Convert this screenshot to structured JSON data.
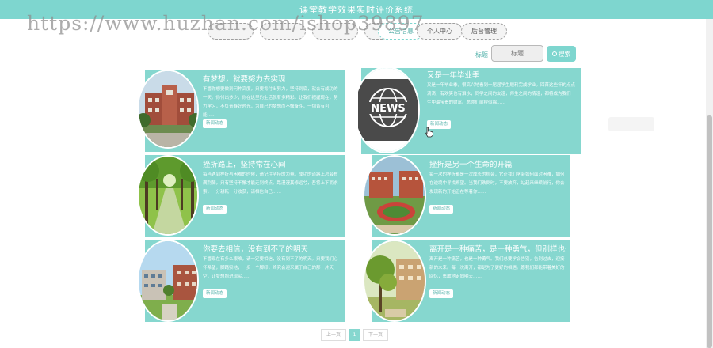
{
  "header": {
    "title": "课堂教学效果实时评价系统"
  },
  "watermark": "https://www.huzhan.com/ishop39897",
  "nav": {
    "tabs": [
      {
        "label": ""
      },
      {
        "label": ""
      },
      {
        "label": ""
      },
      {
        "label": ""
      },
      {
        "label": "公告信息"
      },
      {
        "label": "个人中心"
      },
      {
        "label": "后台管理"
      }
    ],
    "active": 4
  },
  "search": {
    "label": "标题",
    "placeholder": "标题",
    "button_label": "搜索"
  },
  "cards": [
    {
      "title": "有梦想，就要努力去实现",
      "text": "不管你想要做到何种高度，只要肯付出努力，坚持到底，就会有成功的一天。你付出多少，你在这里的生活就有多精彩。让我们把握现在，努力学习，不负青春好时光，为自己的梦想而不懈奋斗，一切皆有可能……",
      "more": "新闻动态"
    },
    {
      "title": "又是一年毕业季",
      "text": "又是一年毕业季，很高兴地看到一届届学生顺利完成学业。回首这些年的点点滴滴，有欢笑也有泪水，同学之间的友谊，师生之间的情谊，都将成为我们一生中最宝贵的财富。愿你们前程似锦……",
      "more": "新闻动态"
    },
    {
      "title": "挫折路上，坚持常在心间",
      "text": "每当遇到挫折与困难的时候，请记住坚持的力量。成功的道路上总会布满荆棘，只有坚持不懈才能走到终点。路漫漫其修远兮，吾将上下而求索，一分耕耘一分收获，请相信自己……",
      "more": "新闻动态"
    },
    {
      "title": "挫折是另一个生命的开篇",
      "text": "每一次的挫折都是一次成长的机会，它让我们学会如何面对困难，如何在逆境中寻找希望。当我们跌倒时，不要放弃，站起来继续前行，你会发现新的开始正在等着你……",
      "more": "新闻动态"
    },
    {
      "title": "你要去相信，没有到不了的明天",
      "text": "不管现在有多么艰难，请一定要相信，没有到不了的明天。只要我们心怀希望，脚踏实地，一步一个脚印，终究会迎来属于自己的那一片天空，让梦想照进现实……",
      "more": "新闻动态"
    },
    {
      "title": "离开是一种痛苦，是一种勇气，但别样也是……",
      "text": "离开是一种痛苦，也是一种勇气。我们总要学会告别，告别过去，迎接新的未来。每一次离开，都是为了更好的相遇。愿我们都能带着美好的回忆，勇敢地走向明天……",
      "more": "新闻动态"
    }
  ],
  "pagination": {
    "prev": "上一页",
    "current": "1",
    "next": "下一页"
  }
}
